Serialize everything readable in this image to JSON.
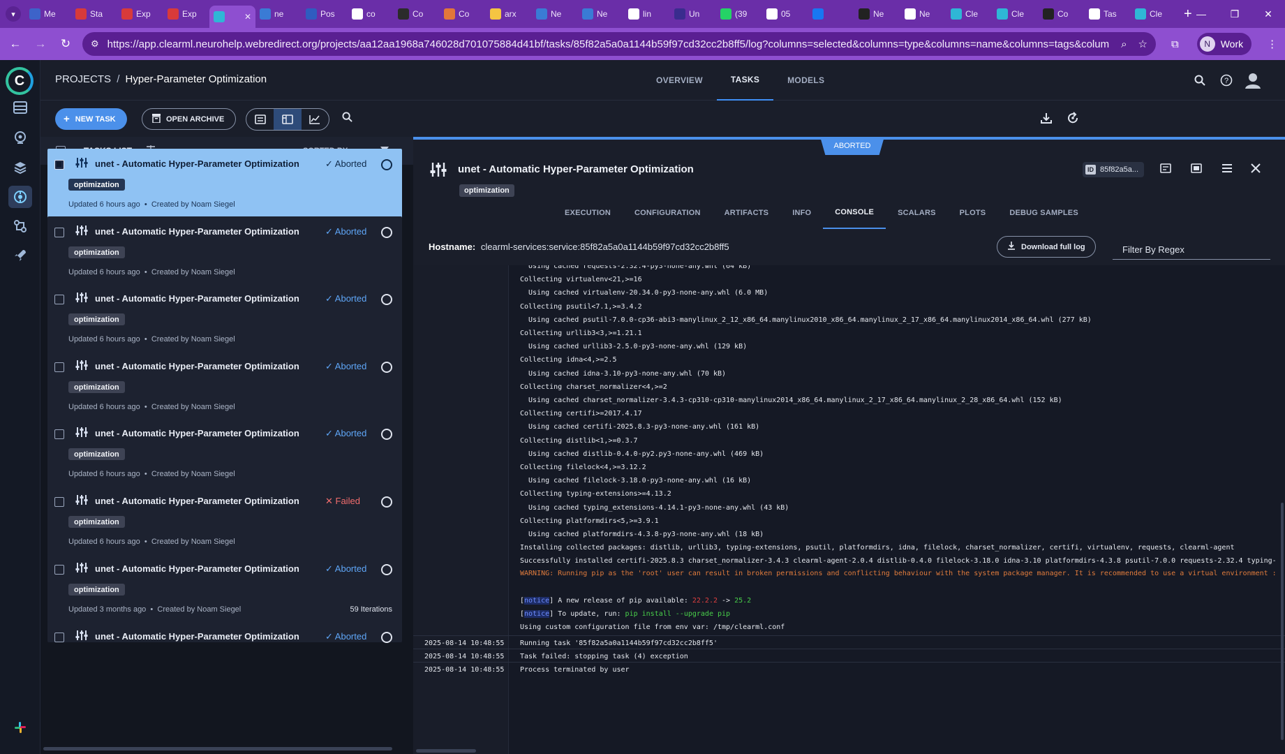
{
  "browser": {
    "tabs": [
      {
        "label": "Me",
        "color": "#3d63c9"
      },
      {
        "label": "Sta",
        "color": "#d83a3a"
      },
      {
        "label": "Exp",
        "color": "#d83a3a"
      },
      {
        "label": "Exp",
        "color": "#d83a3a"
      },
      {
        "label": "",
        "color": "#2fb6d6",
        "active": true
      },
      {
        "label": "ne",
        "color": "#3a7bd5"
      },
      {
        "label": "Pos",
        "color": "#2f5cc0"
      },
      {
        "label": "co",
        "color": "#ffffff"
      },
      {
        "label": "Co",
        "color": "#2b2b2b"
      },
      {
        "label": "Co",
        "color": "#e2763a"
      },
      {
        "label": "arx",
        "color": "#f5c542"
      },
      {
        "label": "Ne",
        "color": "#3a7bd5"
      },
      {
        "label": "Ne",
        "color": "#3a7bd5"
      },
      {
        "label": "lin",
        "color": "#ffffff"
      },
      {
        "label": "Un",
        "color": "#3a2c8e"
      },
      {
        "label": "(39",
        "color": "#25d366"
      },
      {
        "label": "05",
        "color": "#ffffff"
      },
      {
        "label": "",
        "color": "#1877f2"
      },
      {
        "label": "Ne",
        "color": "#222222"
      },
      {
        "label": "Ne",
        "color": "#ffffff"
      },
      {
        "label": "Cle",
        "color": "#2fb6d6"
      },
      {
        "label": "Cle",
        "color": "#2fb6d6"
      },
      {
        "label": "Co",
        "color": "#222222"
      },
      {
        "label": "Tas",
        "color": "#ffffff"
      },
      {
        "label": "Cle",
        "color": "#2fb6d6"
      }
    ],
    "url": "https://app.clearml.neurohelp.webredirect.org/projects/aa12aa1968a746028d701075884d41bf/tasks/85f82a5a0a1144b59f97cd32cc2b8ff5/log?columns=selected&columns=type&columns=name&columns=tags&columns=status...",
    "profile_initial": "N",
    "profile_label": "Work"
  },
  "header": {
    "crumb_root": "PROJECTS",
    "crumb_sep": "/",
    "crumb_current": "Hyper-Parameter Optimization",
    "tabs": [
      "OVERVIEW",
      "TASKS",
      "MODELS"
    ]
  },
  "toolbar": {
    "new_task": "NEW TASK",
    "open_archive": "OPEN ARCHIVE"
  },
  "list": {
    "title": "TASKS LIST",
    "sorted_by": "SORTED BY",
    "tasks": [
      {
        "name": "unet - Automatic Hyper-Parameter Optimization",
        "status": "Aborted",
        "tag": "optimization",
        "updated": "Updated 6 hours ago",
        "creator": "Created by Noam Siegel",
        "iterations": ""
      },
      {
        "name": "unet - Automatic Hyper-Parameter Optimization",
        "status": "Aborted",
        "tag": "optimization",
        "updated": "Updated 6 hours ago",
        "creator": "Created by Noam Siegel",
        "iterations": ""
      },
      {
        "name": "unet - Automatic Hyper-Parameter Optimization",
        "status": "Aborted",
        "tag": "optimization",
        "updated": "Updated 6 hours ago",
        "creator": "Created by Noam Siegel",
        "iterations": ""
      },
      {
        "name": "unet - Automatic Hyper-Parameter Optimization",
        "status": "Aborted",
        "tag": "optimization",
        "updated": "Updated 6 hours ago",
        "creator": "Created by Noam Siegel",
        "iterations": ""
      },
      {
        "name": "unet - Automatic Hyper-Parameter Optimization",
        "status": "Aborted",
        "tag": "optimization",
        "updated": "Updated 6 hours ago",
        "creator": "Created by Noam Siegel",
        "iterations": ""
      },
      {
        "name": "unet - Automatic Hyper-Parameter Optimization",
        "status": "Failed",
        "tag": "optimization",
        "updated": "Updated 6 hours ago",
        "creator": "Created by Noam Siegel",
        "iterations": ""
      },
      {
        "name": "unet - Automatic Hyper-Parameter Optimization",
        "status": "Aborted",
        "tag": "optimization",
        "updated": "Updated 3 months ago",
        "creator": "Created by Noam Siegel",
        "iterations": "59 Iterations"
      },
      {
        "name": "unet - Automatic Hyper-Parameter Optimization",
        "status": "Aborted",
        "tag": "",
        "updated": "",
        "creator": "",
        "iterations": ""
      }
    ]
  },
  "detail": {
    "status_badge": "ABORTED",
    "title": "unet - Automatic Hyper-Parameter Optimization",
    "tag": "optimization",
    "id_label": "ID",
    "id_short": "85f82a5a...",
    "tabs": [
      "EXECUTION",
      "CONFIGURATION",
      "ARTIFACTS",
      "INFO",
      "CONSOLE",
      "SCALARS",
      "PLOTS",
      "DEBUG SAMPLES"
    ],
    "hostname_label": "Hostname:",
    "hostname": "clearml-services:service:85f82a5a0a1144b59f97cd32cc2b8ff5",
    "download_log": "Download full log",
    "filter_placeholder": "Filter By Regex"
  },
  "console": {
    "lines": [
      "  Using cached requests-2.32.4-py3-none-any.whl (64 kB)",
      "Collecting virtualenv<21,>=16",
      "  Using cached virtualenv-20.34.0-py3-none-any.whl (6.0 MB)",
      "Collecting psutil<7.1,>=3.4.2",
      "  Using cached psutil-7.0.0-cp36-abi3-manylinux_2_12_x86_64.manylinux2010_x86_64.manylinux_2_17_x86_64.manylinux2014_x86_64.whl (277 kB)",
      "Collecting urllib3<3,>=1.21.1",
      "  Using cached urllib3-2.5.0-py3-none-any.whl (129 kB)",
      "Collecting idna<4,>=2.5",
      "  Using cached idna-3.10-py3-none-any.whl (70 kB)",
      "Collecting charset_normalizer<4,>=2",
      "  Using cached charset_normalizer-3.4.3-cp310-cp310-manylinux2014_x86_64.manylinux_2_17_x86_64.manylinux_2_28_x86_64.whl (152 kB)",
      "Collecting certifi>=2017.4.17",
      "  Using cached certifi-2025.8.3-py3-none-any.whl (161 kB)",
      "Collecting distlib<1,>=0.3.7",
      "  Using cached distlib-0.4.0-py2.py3-none-any.whl (469 kB)",
      "Collecting filelock<4,>=3.12.2",
      "  Using cached filelock-3.18.0-py3-none-any.whl (16 kB)",
      "Collecting typing-extensions>=4.13.2",
      "  Using cached typing_extensions-4.14.1-py3-none-any.whl (43 kB)",
      "Collecting platformdirs<5,>=3.9.1",
      "  Using cached platformdirs-4.3.8-py3-none-any.whl (18 kB)",
      "Installing collected packages: distlib, urllib3, typing-extensions, psutil, platformdirs, idna, filelock, charset_normalizer, certifi, virtualenv, requests, clearml-agent",
      "Successfully installed certifi-2025.8.3 charset_normalizer-3.4.3 clearml-agent-2.0.4 distlib-0.4.0 filelock-3.18.0 idna-3.10 platformdirs-4.3.8 psutil-7.0.0 requests-2.32.4 typing-"
    ],
    "warning": "WARNING: Running pip as the 'root' user can result in broken permissions and conflicting behaviour with the system package manager. It is recommended to use a virtual environment :",
    "notice_tag": "notice",
    "notice1_text": " A new release of pip available: ",
    "notice1_old": "22.2.2",
    "notice1_arrow": " -> ",
    "notice1_new": "25.2",
    "notice2_text": " To update, run: ",
    "notice2_cmd": "pip install --upgrade pip",
    "config_line": "Using custom configuration file from env var: /tmp/clearml.conf",
    "timed": [
      {
        "ts": "2025-08-14 10:48:55",
        "msg": "Running task '85f82a5a0a1144b59f97cd32cc2b8ff5'"
      },
      {
        "ts": "2025-08-14 10:48:55",
        "msg": "Task failed: stopping task (4) exception"
      },
      {
        "ts": "2025-08-14 10:48:55",
        "msg": "Process terminated by user"
      }
    ]
  }
}
